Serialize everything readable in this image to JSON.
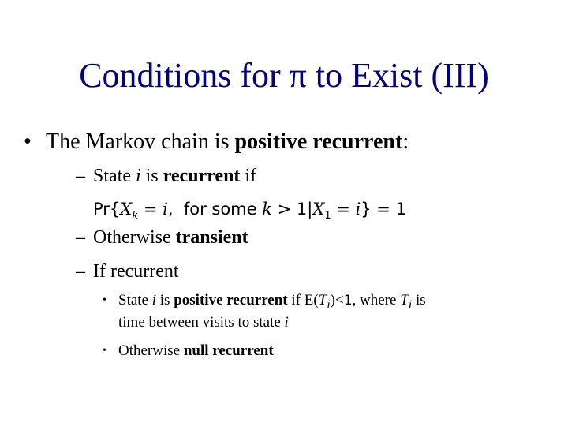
{
  "slide": {
    "title": "Conditions for π to Exist (III)",
    "bullet1": {
      "marker": "•",
      "text": "The Markov chain is ",
      "bold": "positive recurrent",
      "suffix": ":"
    },
    "sub1": {
      "marker": "–",
      "pre": "State ",
      "var": "i",
      "mid": " is ",
      "bold": "recurrent",
      "post": " if"
    },
    "formula": {
      "pr": "Pr{",
      "x": "X",
      "k_sub": "k",
      "eq1": " = ",
      "i1": "i",
      "comma": ",  for some ",
      "k": "k",
      "gt": " > 1|",
      "x2": "X",
      "one_sub": "1",
      "eq2": " = ",
      "i2": "i",
      "close": "} = 1"
    },
    "sub2": {
      "marker": "–",
      "text": "Otherwise ",
      "bold": "transient"
    },
    "sub3": {
      "marker": "–",
      "text": "If recurrent"
    },
    "subsub1": {
      "marker": "•",
      "pre": "State ",
      "var": "i",
      "mid": " is ",
      "bold": "positive recurrent",
      "post1": " if E(",
      "t": "T",
      "t_sub": "i",
      "post2": ")<",
      "one": "1",
      "post3": ", where ",
      "t2": "T",
      "t2_sub": "i",
      "post4": " is",
      "cont": "time between visits to state ",
      "cont_var": "i"
    },
    "subsub2": {
      "marker": "•",
      "text": "Otherwise ",
      "bold": "null recurrent"
    }
  }
}
